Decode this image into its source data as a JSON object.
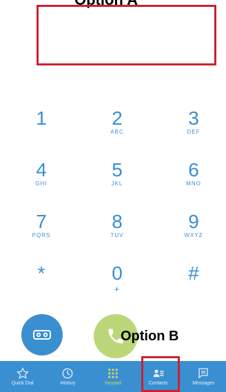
{
  "annotations": {
    "option_a": "Option A",
    "option_b": "Option B",
    "box_color": "#cc2030"
  },
  "keypad": {
    "keys": [
      {
        "digit": "1",
        "letters": ""
      },
      {
        "digit": "2",
        "letters": "ABC"
      },
      {
        "digit": "3",
        "letters": "DEF"
      },
      {
        "digit": "4",
        "letters": "GHI"
      },
      {
        "digit": "5",
        "letters": "JKL"
      },
      {
        "digit": "6",
        "letters": "MNO"
      },
      {
        "digit": "7",
        "letters": "PQRS"
      },
      {
        "digit": "8",
        "letters": "TUV"
      },
      {
        "digit": "9",
        "letters": "WXYZ"
      },
      {
        "digit": "*",
        "letters": ""
      },
      {
        "digit": "0",
        "letters": "+"
      },
      {
        "digit": "#",
        "letters": ""
      }
    ],
    "digit_color": "#3a8fd1"
  },
  "actions": {
    "voicemail_icon": "voicemail-icon",
    "call_icon": "phone-icon",
    "voicemail_color": "#3a8fd1",
    "call_color": "#bcd77a"
  },
  "tabbar": {
    "background": "#3a8fd1",
    "active_color": "#c9d66a",
    "tabs": [
      {
        "label": "Quick Dial",
        "icon": "star-icon",
        "active": false
      },
      {
        "label": "History",
        "icon": "clock-icon",
        "active": false
      },
      {
        "label": "Keypad",
        "icon": "keypad-icon",
        "active": true
      },
      {
        "label": "Contacts",
        "icon": "contacts-icon",
        "active": false
      },
      {
        "label": "Messages",
        "icon": "message-icon",
        "active": false
      }
    ]
  }
}
